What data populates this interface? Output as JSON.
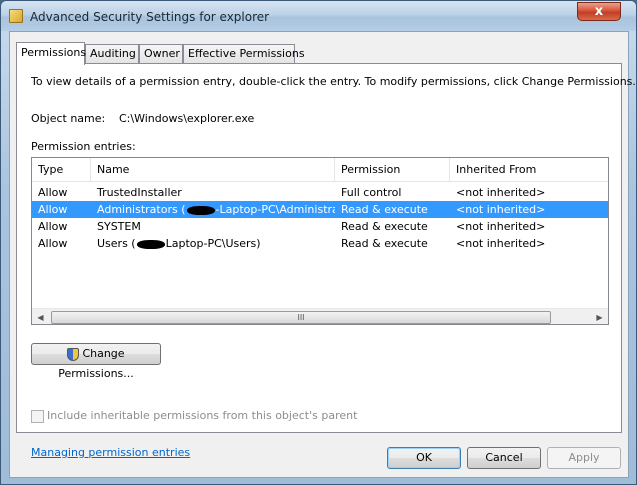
{
  "window": {
    "title": "Advanced Security Settings for explorer",
    "close_glyph": "x"
  },
  "tabs": [
    {
      "label": "Permissions",
      "active": true
    },
    {
      "label": "Auditing"
    },
    {
      "label": "Owner"
    },
    {
      "label": "Effective Permissions"
    }
  ],
  "permissions": {
    "description": "To view details of a permission entry, double-click the entry. To modify permissions, click Change Permissions.",
    "object_name_label": "Object name:",
    "object_name_value": "C:\\Windows\\explorer.exe",
    "entries_label": "Permission entries:",
    "columns": [
      "Type",
      "Name",
      "Permission",
      "Inherited From"
    ],
    "rows": [
      {
        "type": "Allow",
        "name_pre": "TrustedInstaller",
        "name_post": "",
        "redacted": false,
        "permission": "Full control",
        "inherited": "<not inherited>",
        "selected": false
      },
      {
        "type": "Allow",
        "name_pre": "Administrators (",
        "name_post": "-Laptop-PC\\Administrators)",
        "redacted": true,
        "permission": "Read & execute",
        "inherited": "<not inherited>",
        "selected": true
      },
      {
        "type": "Allow",
        "name_pre": "SYSTEM",
        "name_post": "",
        "redacted": false,
        "permission": "Read & execute",
        "inherited": "<not inherited>",
        "selected": false
      },
      {
        "type": "Allow",
        "name_pre": "Users (",
        "name_post": "Laptop-PC\\Users)",
        "redacted": true,
        "permission": "Read & execute",
        "inherited": "<not inherited>",
        "selected": false
      }
    ],
    "scroll_thumb_glyph": "III",
    "change_button": "Change Permissions...",
    "include_inheritable": "Include inheritable permissions from this object's parent",
    "include_checked": false,
    "help_link": "Managing permission entries"
  },
  "footer": {
    "ok": "OK",
    "cancel": "Cancel",
    "apply": "Apply"
  }
}
